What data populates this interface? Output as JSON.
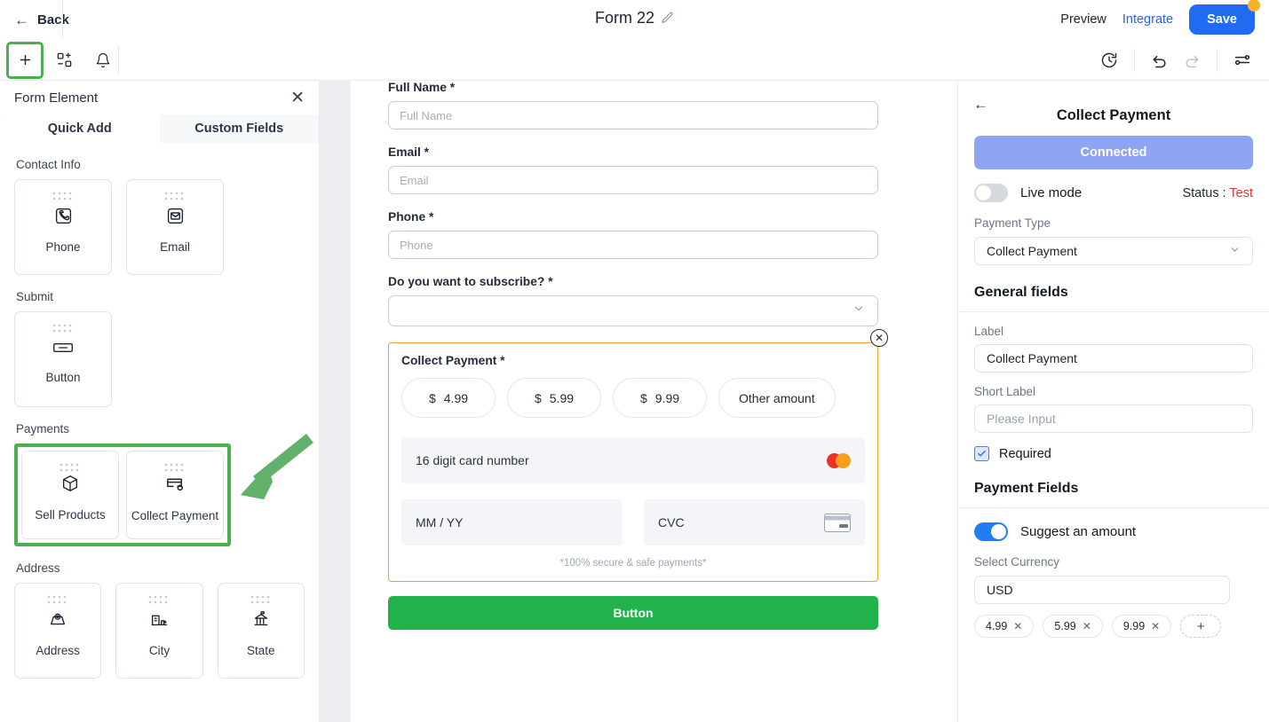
{
  "header": {
    "back_label": "Back",
    "form_title": "Form 22",
    "edit_icon": "pencil-icon",
    "preview_label": "Preview",
    "integrate_label": "Integrate",
    "save_label": "Save"
  },
  "toolbar": {
    "left_icons": [
      "plus-icon",
      "components-icon",
      "bell-icon"
    ],
    "right_icons": [
      "history-icon",
      "undo-icon",
      "redo-icon",
      "settings-sliders-icon"
    ]
  },
  "left_panel": {
    "title": "Form Element",
    "close_icon": "close-icon",
    "tabs": [
      {
        "label": "Quick Add",
        "active": true
      },
      {
        "label": "Custom Fields",
        "active": false
      }
    ],
    "groups": [
      {
        "title": "Contact Info",
        "highlighted": false,
        "items": [
          {
            "label": "Phone",
            "icon": "phone-icon"
          },
          {
            "label": "Email",
            "icon": "envelope-icon"
          }
        ]
      },
      {
        "title": "Submit",
        "highlighted": false,
        "items": [
          {
            "label": "Button",
            "icon": "button-icon"
          }
        ]
      },
      {
        "title": "Payments",
        "highlighted": true,
        "items": [
          {
            "label": "Sell Products",
            "icon": "box-icon"
          },
          {
            "label": "Collect Payment",
            "icon": "credit-card-icon"
          }
        ]
      },
      {
        "title": "Address",
        "highlighted": false,
        "items": [
          {
            "label": "Address",
            "icon": "map-pin-icon"
          },
          {
            "label": "City",
            "icon": "city-icon"
          },
          {
            "label": "State",
            "icon": "bank-icon"
          }
        ]
      }
    ]
  },
  "canvas": {
    "fields": [
      {
        "label": "Full Name *",
        "placeholder": "Full Name",
        "type": "text"
      },
      {
        "label": "Email *",
        "placeholder": "Email",
        "type": "text"
      },
      {
        "label": "Phone *",
        "placeholder": "Phone",
        "type": "text"
      },
      {
        "label": "Do you want to subscribe? *",
        "placeholder": "",
        "type": "select"
      }
    ],
    "payment_block": {
      "label": "Collect Payment *",
      "close_icon": "close-circle-icon",
      "amounts": [
        {
          "currency": "$",
          "value": "4.99"
        },
        {
          "currency": "$",
          "value": "5.99"
        },
        {
          "currency": "$",
          "value": "9.99"
        }
      ],
      "other_amount_label": "Other amount",
      "card_number_placeholder": "16 digit card number",
      "card_brand_icon": "mastercard-icon",
      "expiry_placeholder": "MM / YY",
      "cvc_placeholder": "CVC",
      "cvc_icon": "card-back-icon",
      "secure_note": "*100% secure & safe payments*"
    },
    "submit_button_label": "Button"
  },
  "right_panel": {
    "back_icon": "arrow-left-icon",
    "title": "Collect Payment",
    "connected_label": "Connected",
    "live_mode_label": "Live mode",
    "live_mode_on": false,
    "status_prefix": "Status : ",
    "status_value": "Test",
    "payment_type_label": "Payment Type",
    "payment_type_value": "Collect Payment",
    "general_fields_title": "General fields",
    "label_field_label": "Label",
    "label_field_value": "Collect Payment",
    "short_label_field_label": "Short Label",
    "short_label_placeholder": "Please Input",
    "required_label": "Required",
    "required_checked": true,
    "payment_fields_title": "Payment Fields",
    "suggest_amount_label": "Suggest an amount",
    "suggest_amount_on": true,
    "select_currency_label": "Select Currency",
    "currency_value": "USD",
    "amount_chips": [
      "4.99",
      "5.99",
      "9.99"
    ],
    "add_chip_label": "+"
  },
  "annotations": {
    "arrow_color": "#62b06a",
    "highlight_color": "#4caf50"
  }
}
